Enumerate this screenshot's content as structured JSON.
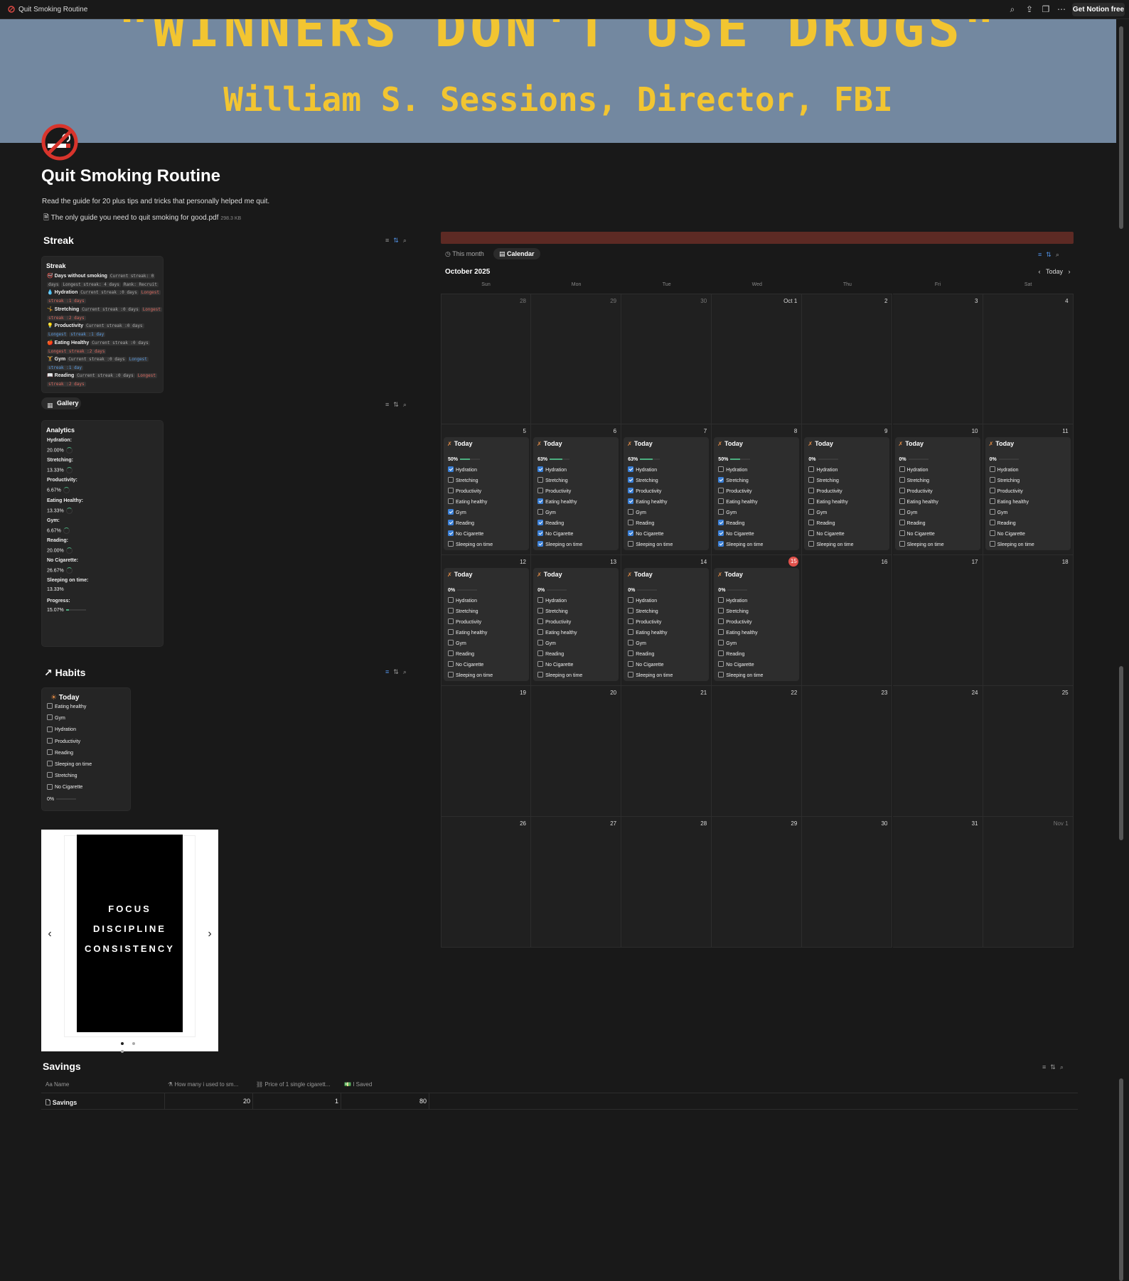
{
  "topbar": {
    "page_title": "Quit Smoking Routine",
    "get_notion": "Get Notion free"
  },
  "cover": {
    "quote": "\"WINNERS DON'T USE DRUGS\"",
    "attribution": "William S. Sessions, Director, FBI"
  },
  "page": {
    "title": "Quit Smoking Routine",
    "description": "Read the guide for 20 plus tips and tricks that personally helped me quit.",
    "file_name": "The only guide you need to quit smoking for good.pdf",
    "file_size": "298.3 KB"
  },
  "streak": {
    "heading": "Streak",
    "card_title": "Streak",
    "rows": [
      {
        "icon": "🚭",
        "label": "Days without smoking",
        "p1": "Current streak: 0",
        "p2": "days",
        "p3": "Longest streak: 4 days",
        "p4": "Rank: Recruit"
      },
      {
        "icon": "💧",
        "label": "Hydration",
        "p1": "Current streak :0 days",
        "p2": "Longest",
        "p3": "streak :1 days",
        "p4": ""
      },
      {
        "icon": "🤸",
        "label": "Stretching",
        "p1": "Current streak :0 days",
        "p2": "Longest",
        "p3": "streak :2 days",
        "p4": ""
      },
      {
        "icon": "💡",
        "label": "Productivity",
        "p1": "Current streak :0 days",
        "p2": "Longest",
        "p3": "streak :1 day",
        "p4": ""
      },
      {
        "icon": "🍎",
        "label": "Eating Healthy",
        "p1": "Current streak :0 days",
        "p2": "",
        "p3": "Longest  streak :2 days",
        "p4": ""
      },
      {
        "icon": "🏋",
        "label": "Gym",
        "p1": "Current streak :0 days",
        "p2": "Longest",
        "p3": "streak :1 day",
        "p4": ""
      },
      {
        "icon": "📖",
        "label": "Reading",
        "p1": "Current streak :0 days",
        "p2": "Longest",
        "p3": "streak :2 days",
        "p4": ""
      }
    ]
  },
  "gallery": {
    "label": "Gallery"
  },
  "analytics": {
    "title": "Analytics",
    "items": [
      {
        "label": "Hydration:",
        "value": "20.00%"
      },
      {
        "label": "Stretching:",
        "value": "13.33%"
      },
      {
        "label": "Productivity:",
        "value": "6.67%"
      },
      {
        "label": "Eating Healthy:",
        "value": "13.33%"
      },
      {
        "label": "Gym:",
        "value": "6.67%"
      },
      {
        "label": "Reading:",
        "value": "20.00%"
      },
      {
        "label": "No Cigarette:",
        "value": "26.67%"
      },
      {
        "label": "Sleeping on time:",
        "value": "13.33%"
      },
      {
        "label": "Progress:",
        "value": "15.07%"
      }
    ],
    "progress_fraction": 0.1507
  },
  "habits": {
    "heading": "Habits",
    "card_title": "Today",
    "items": [
      "Eating healthy",
      "Gym",
      "Hydration",
      "Productivity",
      "Reading",
      "Sleeping on time",
      "Stretching",
      "No Cigarette"
    ],
    "progress": "0%"
  },
  "carousel": {
    "lines": [
      "FOCUS",
      "DISCIPLINE",
      "CONSISTENCY"
    ]
  },
  "calendar": {
    "tab_this_month": "This month",
    "tab_calendar": "Calendar",
    "month": "October 2025",
    "today_btn": "Today",
    "weekdays": [
      "Sun",
      "Mon",
      "Tue",
      "Wed",
      "Thu",
      "Fri",
      "Sat"
    ],
    "habit_labels": [
      "Hydration",
      "Stretching",
      "Productivity",
      "Eating healthy",
      "Gym",
      "Reading",
      "No Cigarette",
      "Sleeping on time"
    ],
    "weeks": [
      [
        {
          "d": "28",
          "dim": true
        },
        {
          "d": "29",
          "dim": true
        },
        {
          "d": "30",
          "dim": true
        },
        {
          "d": "Oct 1"
        },
        {
          "d": "2"
        },
        {
          "d": "3"
        },
        {
          "d": "4"
        }
      ],
      [
        {
          "d": "5",
          "ev": {
            "title": "Today",
            "pct": "50%",
            "frac": 0.5,
            "checks": [
              1,
              0,
              0,
              0,
              1,
              1,
              1,
              0
            ]
          }
        },
        {
          "d": "6",
          "ev": {
            "title": "Today",
            "pct": "63%",
            "frac": 0.63,
            "checks": [
              1,
              0,
              0,
              1,
              0,
              1,
              1,
              1
            ]
          }
        },
        {
          "d": "7",
          "ev": {
            "title": "Today",
            "pct": "63%",
            "frac": 0.63,
            "checks": [
              1,
              1,
              1,
              1,
              0,
              0,
              1,
              0
            ]
          }
        },
        {
          "d": "8",
          "ev": {
            "title": "Today",
            "pct": "50%",
            "frac": 0.5,
            "checks": [
              0,
              1,
              0,
              0,
              0,
              1,
              1,
              1
            ]
          }
        },
        {
          "d": "9",
          "ev": {
            "title": "Today",
            "pct": "0%",
            "frac": 0,
            "checks": [
              0,
              0,
              0,
              0,
              0,
              0,
              0,
              0
            ]
          }
        },
        {
          "d": "10",
          "ev": {
            "title": "Today",
            "pct": "0%",
            "frac": 0,
            "checks": [
              0,
              0,
              0,
              0,
              0,
              0,
              0,
              0
            ]
          }
        },
        {
          "d": "11",
          "ev": {
            "title": "Today",
            "pct": "0%",
            "frac": 0,
            "checks": [
              0,
              0,
              0,
              0,
              0,
              0,
              0,
              0
            ]
          }
        }
      ],
      [
        {
          "d": "12",
          "ev": {
            "title": "Today",
            "pct": "0%",
            "frac": 0,
            "checks": [
              0,
              0,
              0,
              0,
              0,
              0,
              0,
              0
            ]
          }
        },
        {
          "d": "13",
          "ev": {
            "title": "Today",
            "pct": "0%",
            "frac": 0,
            "checks": [
              0,
              0,
              0,
              0,
              0,
              0,
              0,
              0
            ]
          }
        },
        {
          "d": "14",
          "ev": {
            "title": "Today",
            "pct": "0%",
            "frac": 0,
            "checks": [
              0,
              0,
              0,
              0,
              0,
              0,
              0,
              0
            ]
          }
        },
        {
          "d": "15",
          "today": true,
          "ev": {
            "title": "Today",
            "pct": "0%",
            "frac": 0,
            "checks": [
              0,
              0,
              0,
              0,
              0,
              0,
              0,
              0
            ]
          }
        },
        {
          "d": "16"
        },
        {
          "d": "17"
        },
        {
          "d": "18"
        }
      ],
      [
        {
          "d": "19"
        },
        {
          "d": "20"
        },
        {
          "d": "21"
        },
        {
          "d": "22"
        },
        {
          "d": "23"
        },
        {
          "d": "24"
        },
        {
          "d": "25"
        }
      ],
      [
        {
          "d": "26"
        },
        {
          "d": "27"
        },
        {
          "d": "28"
        },
        {
          "d": "29"
        },
        {
          "d": "30"
        },
        {
          "d": "31"
        },
        {
          "d": "Nov 1",
          "dim": true
        }
      ]
    ]
  },
  "savings": {
    "heading": "Savings",
    "columns": [
      "Name",
      "How many i used to sm...",
      "Price of 1 single cigarett...",
      "I Saved"
    ],
    "row": {
      "name": "Savings",
      "used": "20",
      "price": "1",
      "saved": "80"
    }
  },
  "colors": {
    "background": "#191919",
    "accent_blue": "#3a7fd6",
    "progress_green": "#4caf7f",
    "today_red": "#e0504a",
    "banner": "#5d2a24",
    "cover_text": "#f2c531",
    "cover_bg": "#7388a0"
  }
}
